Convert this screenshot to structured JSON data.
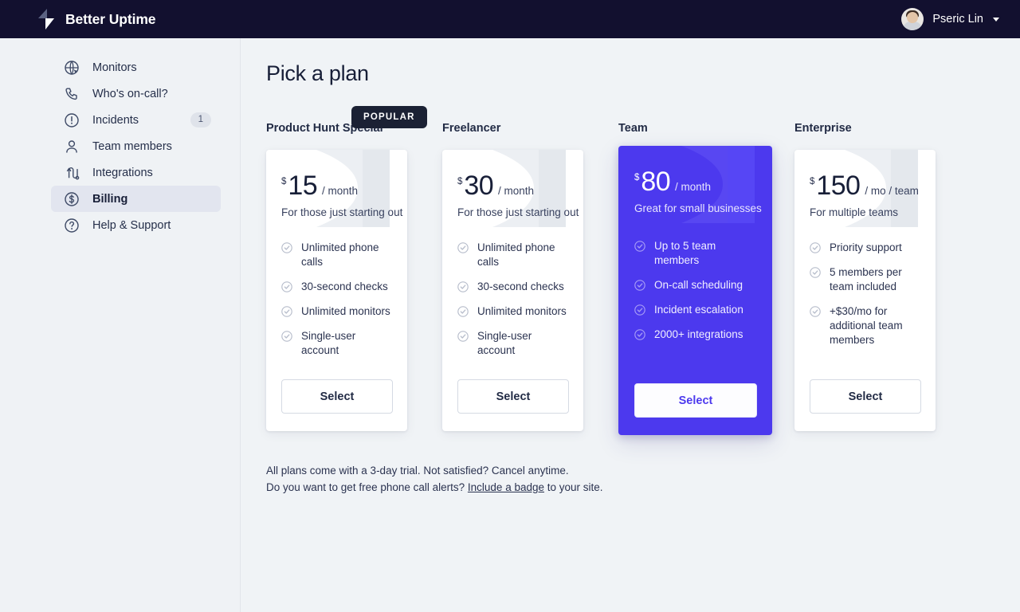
{
  "topbar": {
    "brand_name": "Better Uptime",
    "logo_icon": "lightning-bolt-icon",
    "user_name": "Pseric Lin",
    "avatar_icon": "user-avatar-photo",
    "caret_icon": "chevron-down-icon"
  },
  "sidebar": {
    "items": [
      {
        "label": "Monitors",
        "icon": "globe-icon",
        "badge": "",
        "active": false
      },
      {
        "label": "Who's on-call?",
        "icon": "phone-icon",
        "badge": "",
        "active": false
      },
      {
        "label": "Incidents",
        "icon": "alert-circle-icon",
        "badge": "1",
        "active": false
      },
      {
        "label": "Team members",
        "icon": "user-icon",
        "badge": "",
        "active": false
      },
      {
        "label": "Integrations",
        "icon": "integrations-icon",
        "badge": "",
        "active": false
      },
      {
        "label": "Billing",
        "icon": "dollar-circle-icon",
        "badge": "",
        "active": true
      },
      {
        "label": "Help & Support",
        "icon": "question-circle-icon",
        "badge": "",
        "active": false
      }
    ]
  },
  "main": {
    "page_title": "Pick a plan",
    "popular_badge": "POPULAR",
    "select_label": "Select",
    "plans": [
      {
        "title": "Product Hunt Special",
        "currency": "$",
        "amount": "15",
        "period": "/ month",
        "tagline": "For those just starting out",
        "features": [
          "Unlimited phone calls",
          "30-second checks",
          "Unlimited monitors",
          "Single-user account"
        ],
        "select_label": "Select",
        "featured": false
      },
      {
        "title": "Freelancer",
        "currency": "$",
        "amount": "30",
        "period": "/ month",
        "tagline": "For those just starting out",
        "features": [
          "Unlimited phone calls",
          "30-second checks",
          "Unlimited monitors",
          "Single-user account"
        ],
        "select_label": "Select",
        "featured": false
      },
      {
        "title": "Team",
        "currency": "$",
        "amount": "80",
        "period": "/ month",
        "tagline": "Great for small businesses",
        "features": [
          "Up to 5 team members",
          "On-call scheduling",
          "Incident escalation",
          "2000+ integrations"
        ],
        "select_label": "Select",
        "featured": true
      },
      {
        "title": "Enterprise",
        "currency": "$",
        "amount": "150",
        "period": "/ mo / team",
        "tagline": "For multiple teams",
        "features": [
          "Priority support",
          "5 members per team included",
          "+$30/mo for additional team members"
        ],
        "select_label": "Select",
        "featured": false
      }
    ],
    "footnote": {
      "line1": "All plans come with a 3-day trial. Not satisfied? Cancel anytime.",
      "line2_before": "Do you want to get free phone call alerts? ",
      "line2_link": "Include a badge",
      "line2_after": " to your site."
    }
  },
  "colors": {
    "header_bg": "#12102f",
    "sidebar_bg": "#eff2f5",
    "page_bg": "#f0f3f6",
    "accent_purple": "#4c39ee",
    "text_dark": "#181f38",
    "badge_dark": "#1b2134"
  }
}
